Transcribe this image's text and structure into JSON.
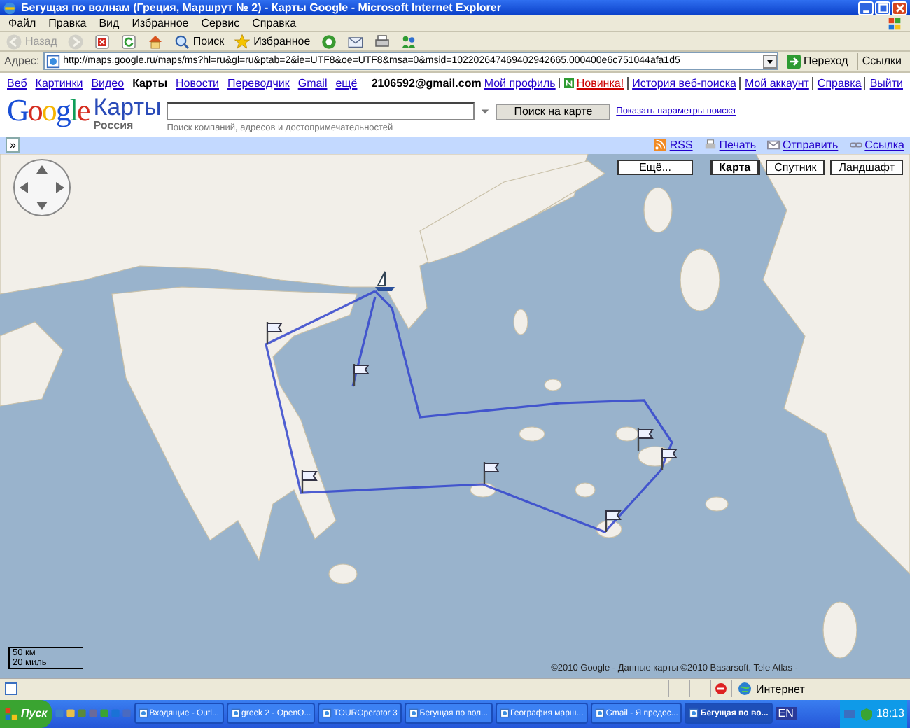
{
  "window": {
    "title": "Бегущая по волнам (Греция, Маршрут № 2) - Карты Google - Microsoft Internet Explorer"
  },
  "menu": [
    "Файл",
    "Правка",
    "Вид",
    "Избранное",
    "Сервис",
    "Справка"
  ],
  "toolbar": [
    {
      "kind": "back",
      "label": "Назад",
      "disabled": true
    },
    {
      "kind": "forward",
      "disabled": true
    },
    {
      "kind": "stop",
      "disabled": false
    },
    {
      "kind": "refresh",
      "disabled": false
    },
    {
      "kind": "home",
      "disabled": false
    },
    {
      "kind": "search",
      "label": "Поиск",
      "disabled": false
    },
    {
      "kind": "favorites",
      "label": "Избранное",
      "disabled": false
    },
    {
      "kind": "media",
      "disabled": false
    },
    {
      "kind": "mail",
      "disabled": false
    },
    {
      "kind": "print",
      "disabled": false
    },
    {
      "kind": "messenger",
      "disabled": false
    }
  ],
  "address": {
    "label": "Адрес:",
    "value": "http://maps.google.ru/maps/ms?hl=ru&gl=ru&ptab=2&ie=UTF8&oe=UTF8&msa=0&msid=102202647469402942665.000400e6c751044afa1d5",
    "go": "Переход",
    "links": "Ссылки"
  },
  "google_nav": [
    {
      "label": "Веб",
      "selected": false
    },
    {
      "label": "Картинки",
      "selected": false
    },
    {
      "label": "Видео",
      "selected": false
    },
    {
      "label": "Карты",
      "selected": true
    },
    {
      "label": "Новости",
      "selected": false
    },
    {
      "label": "Переводчик",
      "selected": false
    },
    {
      "label": "Gmail",
      "selected": false
    },
    {
      "label": "ещё",
      "selected": false
    }
  ],
  "account": {
    "email": "2106592@gmail.com",
    "links": [
      {
        "label": "Мой профиль",
        "kind": "link"
      },
      {
        "label": "Новинка!",
        "kind": "new"
      },
      {
        "label": "История веб-поиска",
        "kind": "link"
      },
      {
        "label": "Мой аккаунт",
        "kind": "link"
      },
      {
        "label": "Справка",
        "kind": "link"
      },
      {
        "label": "Выйти",
        "kind": "link"
      }
    ]
  },
  "header": {
    "logo": "Google",
    "product": "Карты",
    "region": "Россия",
    "search_hint": "Поиск компаний, адресов и достопримечательностей",
    "search_button": "Поиск на карте",
    "options_link": "Показать параметры поиска"
  },
  "map_toolbar": {
    "collapse": "»",
    "links": [
      {
        "label": "RSS",
        "kind": "rss"
      },
      {
        "label": "Печать",
        "kind": "print"
      },
      {
        "label": "Отправить",
        "kind": "mail"
      },
      {
        "label": "Ссылка",
        "kind": "link"
      }
    ]
  },
  "map": {
    "more": "Ещё...",
    "types": [
      {
        "label": "Карта",
        "selected": true
      },
      {
        "label": "Спутник",
        "selected": false
      },
      {
        "label": "Ландшафт",
        "selected": false
      }
    ],
    "scale": [
      "50 км",
      "20 миль"
    ],
    "copyright": "©2010 Google - Данные карты ©2010 Basarsoft, Tele Atlas -",
    "markers": [
      {
        "kind": "start"
      },
      {
        "kind": "flag"
      },
      {
        "kind": "flag"
      },
      {
        "kind": "flag"
      },
      {
        "kind": "flag"
      },
      {
        "kind": "flag"
      },
      {
        "kind": "flag"
      },
      {
        "kind": "flag"
      }
    ]
  },
  "status_bar": {
    "zone": "Интернет"
  },
  "taskbar": {
    "start": "Пуск",
    "tasks": [
      {
        "label": "Входящие - Outl...",
        "selected": false
      },
      {
        "label": "greek 2 - OpenO...",
        "selected": false
      },
      {
        "label": "TOURОperator 3",
        "selected": false
      },
      {
        "label": "Бегущая по вол...",
        "selected": false
      },
      {
        "label": "География марш...",
        "selected": false
      },
      {
        "label": "Gmail - Я предос...",
        "selected": false
      },
      {
        "label": "Бегущая по во...",
        "selected": true
      }
    ],
    "language": "EN",
    "clock": "18:13"
  }
}
